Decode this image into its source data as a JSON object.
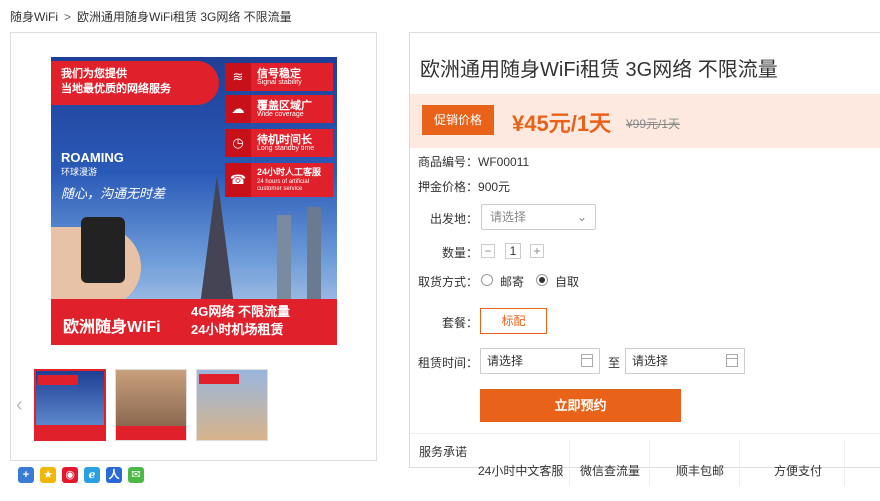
{
  "breadcrumb": {
    "root": "随身WiFi",
    "separator": ">",
    "current": "欧洲通用随身WiFi租赁 3G网络 不限流量"
  },
  "gallery": {
    "main_image": {
      "top_banner": [
        "我们为您提供",
        "当地最优质的网络服务"
      ],
      "features": [
        {
          "icon": "wifi-icon",
          "title": "信号稳定",
          "subtitle": "Signal stability"
        },
        {
          "icon": "cloud-icon",
          "title": "覆盖区域广",
          "subtitle": "Wide coverage"
        },
        {
          "icon": "clock-icon",
          "title": "待机时间长",
          "subtitle": "Long standby time"
        },
        {
          "icon": "support-icon",
          "title": "24小时人工客服",
          "subtitle": "24 hours of artificial customer service"
        }
      ],
      "logo_brand": "ROAMING",
      "logo_sub": "环球漫游",
      "slogan": "随心，沟通无时差",
      "bottom_left": "欧洲随身WiFi",
      "bottom_right_1": "4G网络 不限流量",
      "bottom_right_2": "24小时机场租赁"
    },
    "thumbnails": [
      "thumb-1",
      "thumb-2",
      "thumb-3"
    ],
    "prev_arrow": "‹"
  },
  "share_icons": [
    "add-icon",
    "qzone-icon",
    "weibo-icon",
    "tencent-icon",
    "renren-icon",
    "wechat-icon"
  ],
  "product": {
    "title": "欧洲通用随身WiFi租赁 3G网络 不限流量",
    "promo_label": "促销价格",
    "price": "¥45元/1天",
    "original_price": "¥99元/1天",
    "sku_label": "商品编号：",
    "sku_value": "WF00011",
    "deposit_label": "押金价格：",
    "deposit_value": "900元",
    "origin_label": "出发地：",
    "origin_placeholder": "请选择",
    "qty_label": "数量：",
    "qty_value": "1",
    "pickup_label": "取货方式：",
    "pickup_options": [
      "邮寄",
      "自取"
    ],
    "pickup_selected": "自取",
    "package_label": "套餐：",
    "package_value": "标配",
    "rent_label": "租赁时间：",
    "rent_start": "请选择",
    "rent_to": "至",
    "rent_end": "请选择",
    "book_button": "立即预约",
    "promise_label": "服务承诺",
    "promises": [
      "24小时中文客服",
      "微信查流量",
      "顺丰包邮",
      "方便支付"
    ]
  },
  "colors": {
    "accent": "#e8621a",
    "price_bg": "#fde9e0",
    "brand_red": "#e0202a"
  }
}
